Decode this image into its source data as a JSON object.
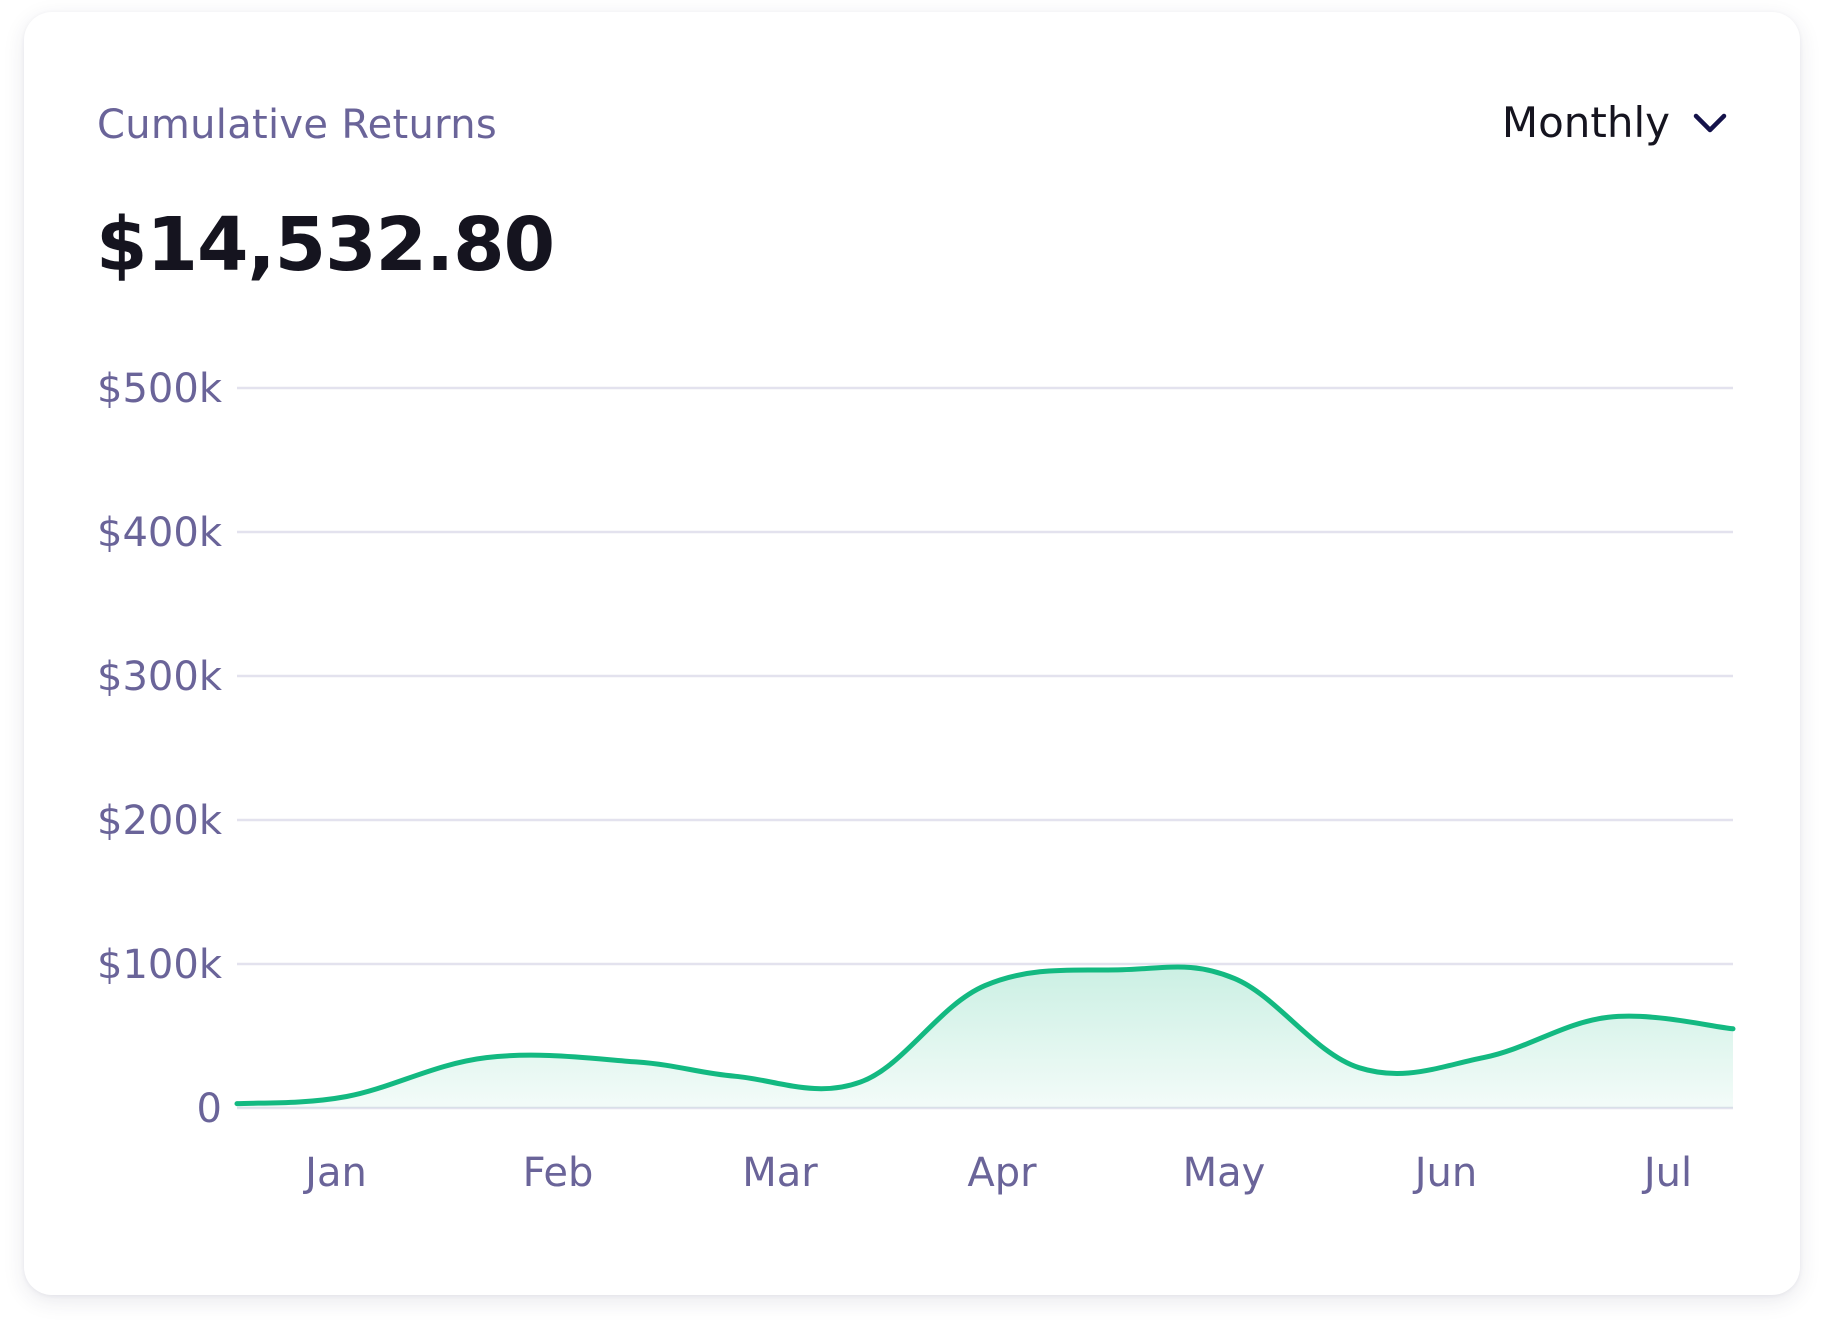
{
  "card": {
    "title": "Cumulative Returns",
    "amount": "$14,532.80",
    "period_selector": {
      "value": "Monthly",
      "icon": "chevron-down-icon"
    }
  },
  "colors": {
    "line": "#13b981",
    "fill": "#13b981",
    "grid": "#e3e2ee",
    "label": "#6a6499",
    "text": "#15141f"
  },
  "chart_data": {
    "type": "area",
    "categories": [
      "Jan",
      "Feb",
      "Mar",
      "Apr",
      "May",
      "Jun",
      "Jul"
    ],
    "y_ticks": [
      {
        "value": 0,
        "label": "0"
      },
      {
        "value": 100000,
        "label": "$100k"
      },
      {
        "value": 200000,
        "label": "$200k"
      },
      {
        "value": 300000,
        "label": "$300k"
      },
      {
        "value": 400000,
        "label": "$400k"
      },
      {
        "value": 500000,
        "label": "$500k"
      }
    ],
    "ylim": [
      0,
      500000
    ],
    "grid": true,
    "series": [
      {
        "x": [
          0,
          0.44,
          1.0,
          1.6,
          2.0,
          2.5,
          3.0,
          3.55,
          4.0,
          4.5,
          5.0,
          5.5,
          6.0
        ],
        "values": [
          3000,
          8000,
          35000,
          32000,
          22000,
          18000,
          85000,
          96000,
          90000,
          28000,
          35000,
          63000,
          55000
        ]
      }
    ]
  }
}
